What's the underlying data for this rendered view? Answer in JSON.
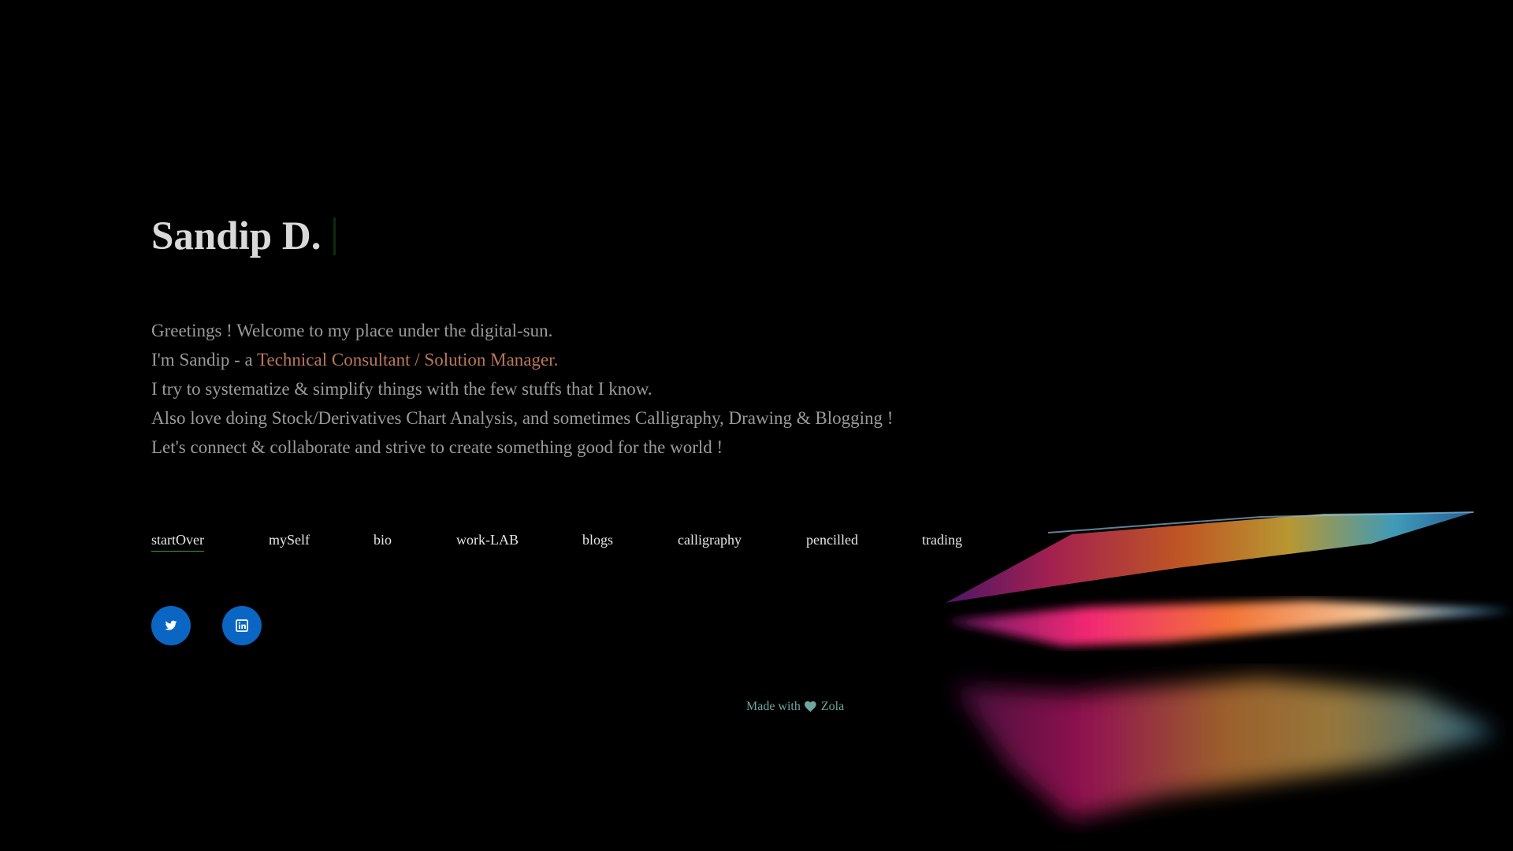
{
  "header": {
    "title": "Sandip D."
  },
  "intro": {
    "line1": "Greetings ! Welcome to my place under the digital-sun.",
    "line2_prefix": "I'm Sandip - a ",
    "line2_role": "Technical Consultant / Solution Manager.",
    "line3": "I try to systematize & simplify things with the few stuffs that I know.",
    "line4": "Also love doing Stock/Derivatives Chart Analysis, and sometimes Calligraphy, Drawing & Blogging !",
    "line5": "Let's connect & collaborate and strive to create something good for the world !"
  },
  "nav": {
    "items": [
      {
        "label": "startOver",
        "active": true
      },
      {
        "label": "mySelf"
      },
      {
        "label": "bio"
      },
      {
        "label": "work-LAB"
      },
      {
        "label": "blogs"
      },
      {
        "label": "calligraphy"
      },
      {
        "label": "pencilled"
      },
      {
        "label": "trading"
      }
    ]
  },
  "social": {
    "items": [
      {
        "icon": "twitter-icon"
      },
      {
        "icon": "linkedin-icon"
      }
    ]
  },
  "footer": {
    "made_with": "Made with",
    "heart_icon": "heart-icon",
    "zola": "Zola"
  },
  "colors": {
    "background": "#000000",
    "accent_role": "#b9785a",
    "nav_underline": "#3d9b3d",
    "social_bg": "#0a66c2",
    "footer_text": "#6fa7a0"
  }
}
